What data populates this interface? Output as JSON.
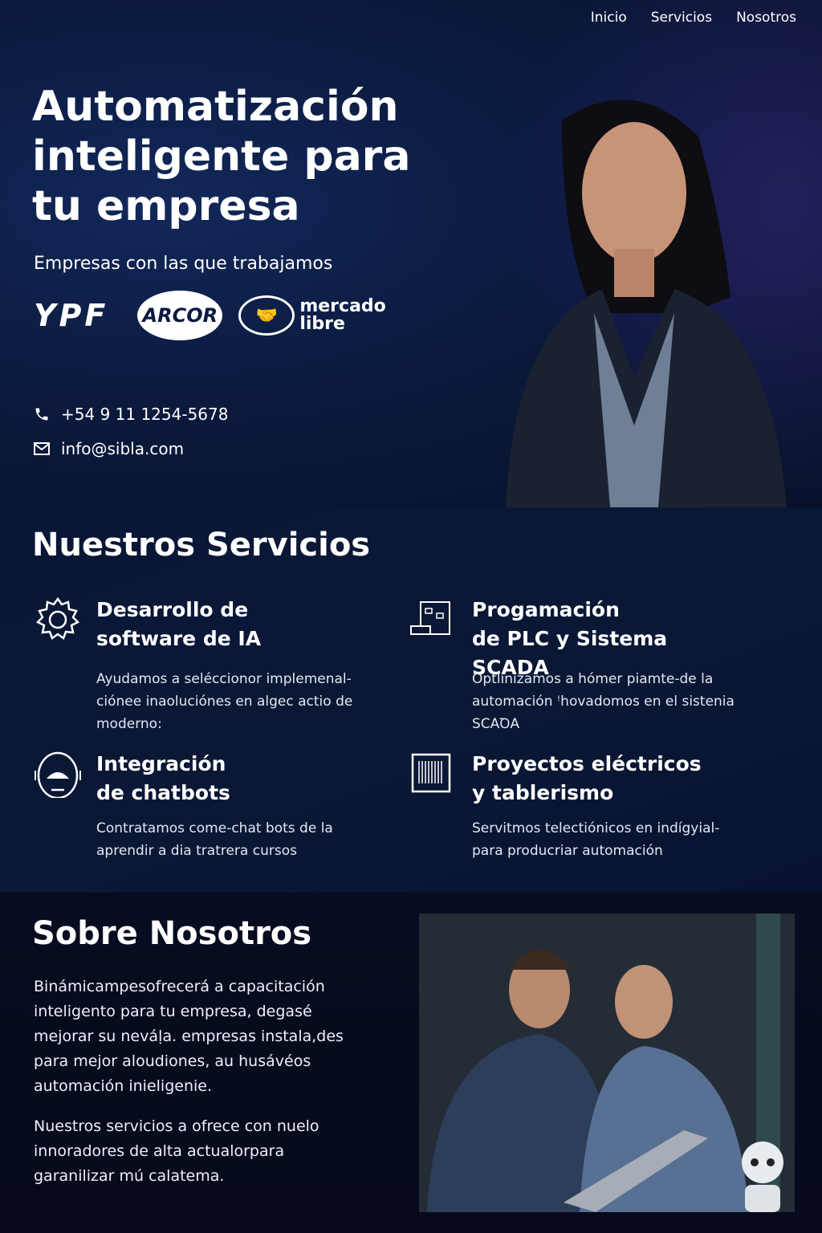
{
  "nav": {
    "items": [
      "Inicio",
      "Servicios",
      "Nosotros"
    ]
  },
  "hero": {
    "title": "Automatización\ninteligente para\ntu empresa",
    "partners_label": "Empresas con las que trabajamos",
    "partners": [
      "YPF",
      "ARCOR",
      "mercado libre"
    ],
    "phone": "+54 9 11 1254-5678",
    "email": "info@sibla.com"
  },
  "services": {
    "title": "Nuestros Servicios",
    "items": [
      {
        "icon": "gear-icon",
        "title": "Desarrollo de\nsoftware de IA",
        "desc": "Ayudamos a seléccionor implemenal-ciónee inaoluciónes en algec actio de moderno:"
      },
      {
        "icon": "plc-diagram-icon",
        "title": "Progamación\nde PLC y Sistema SCADA",
        "desc": "Optlinizamos a hómer piamte-de la automación ꜝhovadomos en el sistenia SCAꝹA"
      },
      {
        "icon": "chatbot-icon",
        "title": "Integración\nde chatbots",
        "desc": "Contratamos come-chat bots de la aprendir a dia tratrera cursos"
      },
      {
        "icon": "electrical-panel-icon",
        "title": "Proyectos eléctricos\ny tablerismo",
        "desc": "Servitmos telectiónicos en indígyial-para producriar automación"
      }
    ]
  },
  "about": {
    "title": "Sobre Nosotros",
    "p1": "Binámicampesofrecerá a capacitación inteligento para tu empresa, degasé mejorar su neváḷa. empresas instala,des para mejor aloudiones, au husávéos automación inieligenie.",
    "p2": "Nuestros servicios a ofrece con nuelo innoradores de alta actualorpara garanilizar mú calatema."
  },
  "colors": {
    "background": "#0b1a3e",
    "text": "#ffffff"
  }
}
